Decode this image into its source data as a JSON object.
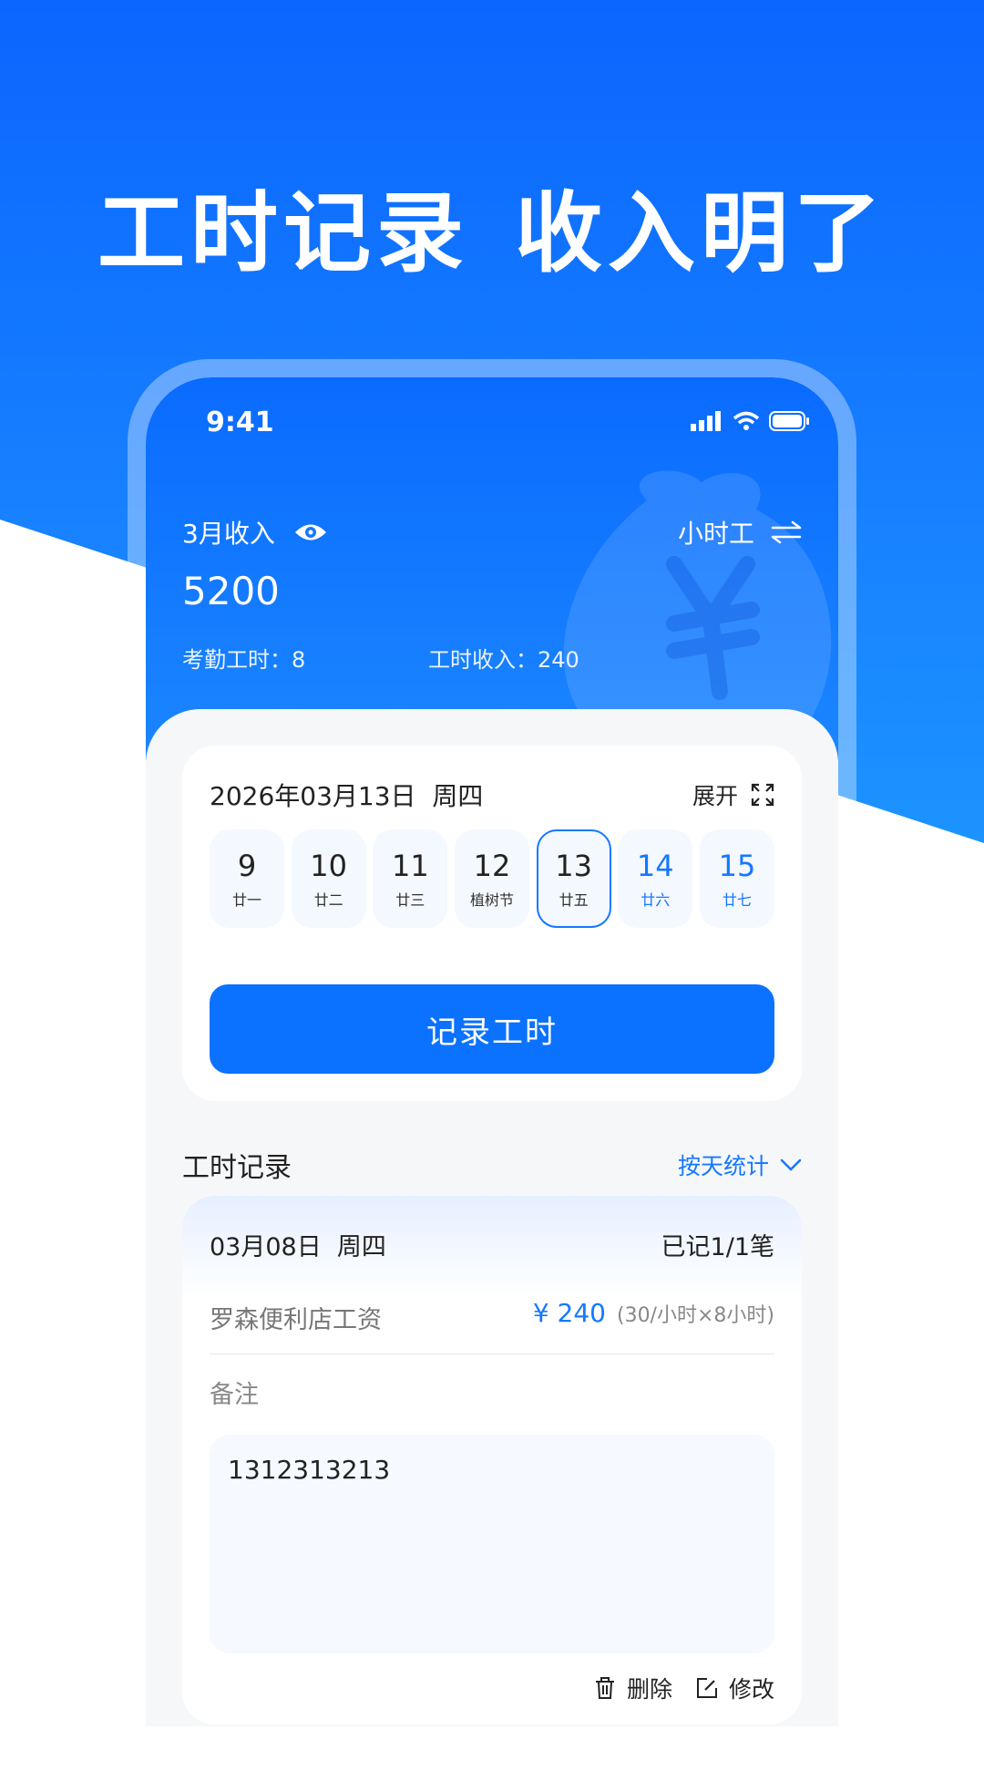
{
  "promo": {
    "title_part1": "工时记录",
    "title_part2": "收入明了"
  },
  "status_bar": {
    "time": "9:41"
  },
  "header": {
    "month_income_label": "3月收入",
    "mode_label": "小时工",
    "total_income": "5200",
    "attendance_hours": "考勤工时：8",
    "hourly_income": "工时收入：240"
  },
  "calendar": {
    "current_date": "2026年03月13日",
    "weekday": "周四",
    "expand_label": "展开",
    "days": [
      {
        "num": "9",
        "lunar": "廿一"
      },
      {
        "num": "10",
        "lunar": "廿二"
      },
      {
        "num": "11",
        "lunar": "廿三"
      },
      {
        "num": "12",
        "lunar": "植树节"
      },
      {
        "num": "13",
        "lunar": "廿五"
      },
      {
        "num": "14",
        "lunar": "廿六"
      },
      {
        "num": "15",
        "lunar": "廿七"
      }
    ],
    "selected_day": "13",
    "record_button": "记录工时"
  },
  "records": {
    "section_title": "工时记录",
    "filter_label": "按天统计",
    "item": {
      "date": "03月08日",
      "weekday": "周四",
      "count": "已记1/1笔",
      "job": "罗森便利店工资",
      "amount": "¥ 240",
      "detail": "(30/小时×8小时)",
      "note_label": "备注",
      "note": "1312313213",
      "delete_label": "删除",
      "edit_label": "修改"
    }
  },
  "colors": {
    "primary": "#0a72ff",
    "accent_text": "#1478ff",
    "background": "#f6f7f9"
  },
  "icons": [
    "eye-icon",
    "swap-icon",
    "expand-icon",
    "chevron-down-icon",
    "trash-icon",
    "edit-icon",
    "signal-icon",
    "wifi-icon",
    "battery-icon"
  ]
}
